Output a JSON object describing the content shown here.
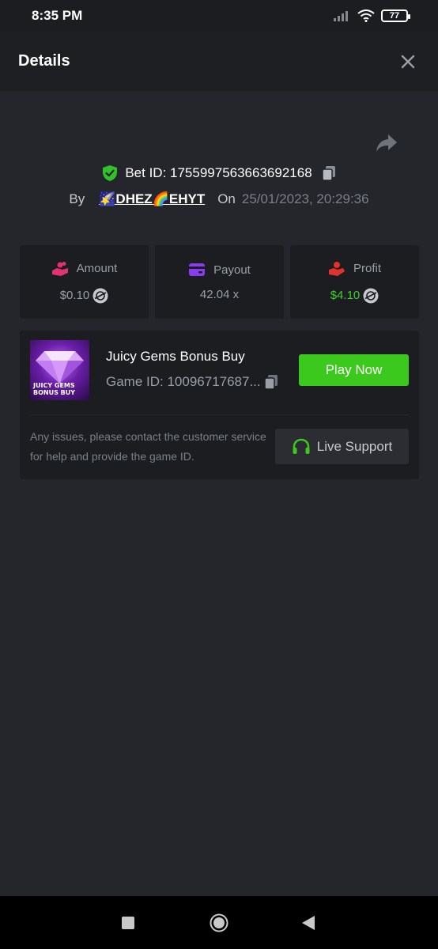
{
  "status_bar": {
    "time": "8:35 PM",
    "battery": "77"
  },
  "header": {
    "title": "Details",
    "close_icon": "close-icon"
  },
  "bet": {
    "id_text": "Bet ID: 1755997563663692168",
    "by_label": "By",
    "username": "🌠DHEZ🌈EHYT",
    "on_label": "On",
    "date": "25/01/2023, 20:29:36"
  },
  "stats": [
    {
      "label": "Amount",
      "value": "$0.10",
      "icon": "coins-hand-icon",
      "color": "#e0336f"
    },
    {
      "label": "Payout",
      "value": "42.04 x",
      "icon": "wallet-card-icon",
      "color": "#8b3cf0"
    },
    {
      "label": "Profit",
      "value": "$4.10",
      "icon": "money-hand-icon",
      "color": "#e0332d"
    }
  ],
  "game": {
    "title": "Juicy Gems Bonus Buy",
    "game_id": "Game ID: 10096717687...",
    "thumb_text_line1": "JUICY GEMS",
    "thumb_text_line2": "BONUS BUY",
    "play_label": "Play Now"
  },
  "support": {
    "text": "Any issues, please contact the customer service for help and provide the game ID.",
    "button_label": "Live Support"
  },
  "colors": {
    "accent_green": "#3cc91e",
    "profit_green": "#3fcf2e",
    "background": "#24262b",
    "card": "#1b1d21"
  }
}
